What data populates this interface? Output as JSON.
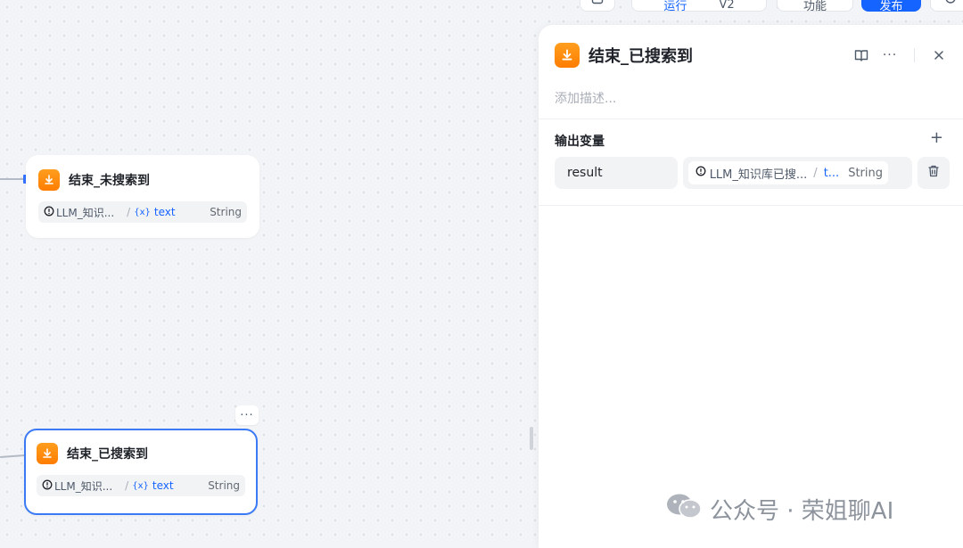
{
  "toolbar": {
    "run_label": "运行",
    "version_label": "V2",
    "features_label": "功能",
    "publish_label": "发布"
  },
  "canvas": {
    "node_not_found": {
      "title": "结束_未搜索到",
      "source": "LLM_知识...",
      "separator": "/",
      "var_name": "text",
      "var_icon": "{x}",
      "type": "String"
    },
    "node_found": {
      "title": "结束_已搜索到",
      "source": "LLM_知识...",
      "separator": "/",
      "var_name": "text",
      "var_icon": "{x}",
      "type": "String",
      "more": "···"
    }
  },
  "panel": {
    "title": "结束_已搜索到",
    "more": "···",
    "description_placeholder": "添加描述...",
    "section_title": "输出变量",
    "add": "+",
    "output": {
      "name": "result",
      "source": "LLM_知识库已搜...",
      "separator": "/",
      "var_name": "t...",
      "type": "String"
    }
  },
  "watermark": {
    "text": "公众号 · 荣姐聊AI"
  },
  "colors": {
    "accent": "#1664ff",
    "node_icon": "#ff7d00",
    "selected_border": "#3b7af5"
  }
}
